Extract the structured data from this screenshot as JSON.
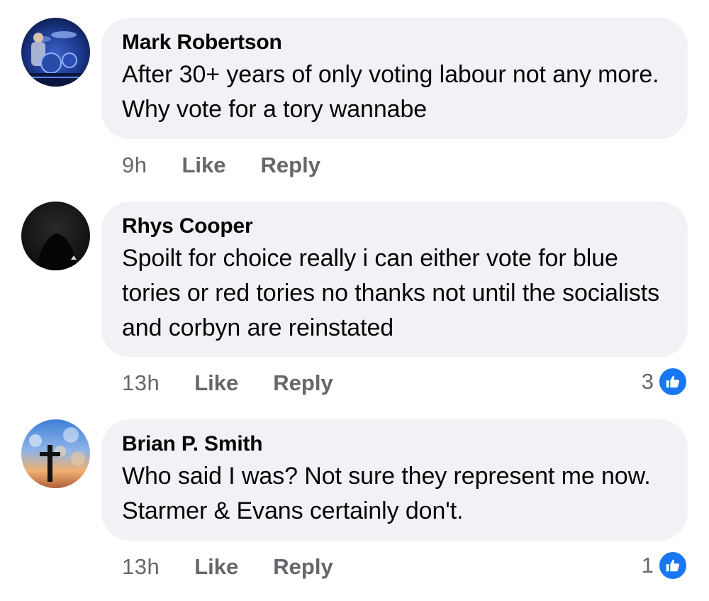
{
  "colors": {
    "bubble": "#f0f2f5",
    "meta": "#65676b",
    "like_blue": "#1877f2"
  },
  "comments": [
    {
      "author": "Mark Robertson",
      "text": "After 30+ years of only voting labour not any more. Why vote for a tory wannabe",
      "time": "9h",
      "like_label": "Like",
      "reply_label": "Reply",
      "avatar_icon": "drummer-photo-avatar"
    },
    {
      "author": "Rhys Cooper",
      "text": "Spoilt for choice really i can either vote for blue tories or red tories no thanks not until the socialists and corbyn are reinstated",
      "time": "13h",
      "like_label": "Like",
      "reply_label": "Reply",
      "reaction_count": "3",
      "avatar_icon": "dark-photo-avatar"
    },
    {
      "author": "Brian P. Smith",
      "text": "Who said I was? Not sure they represent me now. Starmer & Evans certainly don't.",
      "time": "13h",
      "like_label": "Like",
      "reply_label": "Reply",
      "reaction_count": "1",
      "avatar_icon": "cross-sunset-avatar"
    }
  ]
}
